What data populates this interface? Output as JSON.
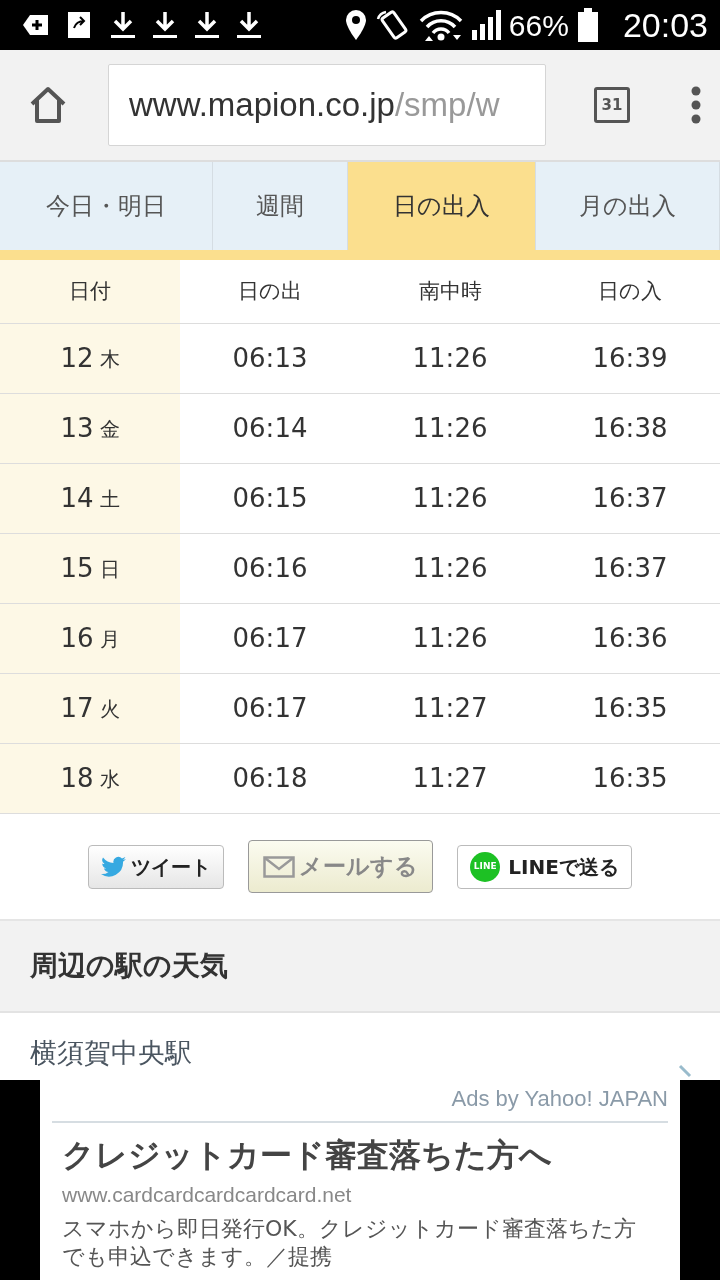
{
  "status_bar": {
    "battery": "66%",
    "time": "20:03"
  },
  "browser": {
    "url_host": "www.mapion.co.jp",
    "url_path": "/smp/w",
    "tab_count": "31"
  },
  "tabs": [
    {
      "label": "今日・明日",
      "selected": false
    },
    {
      "label": "週間",
      "selected": false
    },
    {
      "label": "日の出入",
      "selected": true
    },
    {
      "label": "月の出入",
      "selected": false
    }
  ],
  "table": {
    "columns": [
      "日付",
      "日の出",
      "南中時",
      "日の入"
    ],
    "rows": [
      {
        "day": "12",
        "weekday": "木",
        "sunrise": "06:13",
        "transit": "11:26",
        "sunset": "16:39"
      },
      {
        "day": "13",
        "weekday": "金",
        "sunrise": "06:14",
        "transit": "11:26",
        "sunset": "16:38"
      },
      {
        "day": "14",
        "weekday": "土",
        "sunrise": "06:15",
        "transit": "11:26",
        "sunset": "16:37"
      },
      {
        "day": "15",
        "weekday": "日",
        "sunrise": "06:16",
        "transit": "11:26",
        "sunset": "16:37"
      },
      {
        "day": "16",
        "weekday": "月",
        "sunrise": "06:17",
        "transit": "11:26",
        "sunset": "16:36"
      },
      {
        "day": "17",
        "weekday": "火",
        "sunrise": "06:17",
        "transit": "11:27",
        "sunset": "16:35"
      },
      {
        "day": "18",
        "weekday": "水",
        "sunrise": "06:18",
        "transit": "11:27",
        "sunset": "16:35"
      }
    ]
  },
  "share_buttons": [
    {
      "kind": "tweet",
      "label": "ツイート"
    },
    {
      "kind": "mail",
      "label": "メールする"
    },
    {
      "kind": "line",
      "label": "LINEで送る",
      "badge": "LINE"
    }
  ],
  "section": {
    "title": "周辺の駅の天気",
    "stations": [
      "横須賀中央駅"
    ]
  },
  "ad": {
    "provider": "Ads by Yahoo! JAPAN",
    "title": "クレジットカード審査落ちた方へ",
    "url": "www.cardcardcardcardcard.net",
    "description": "スマホから即日発行OK。クレジットカード審査落ちた方でも申込できます。／提携"
  }
}
